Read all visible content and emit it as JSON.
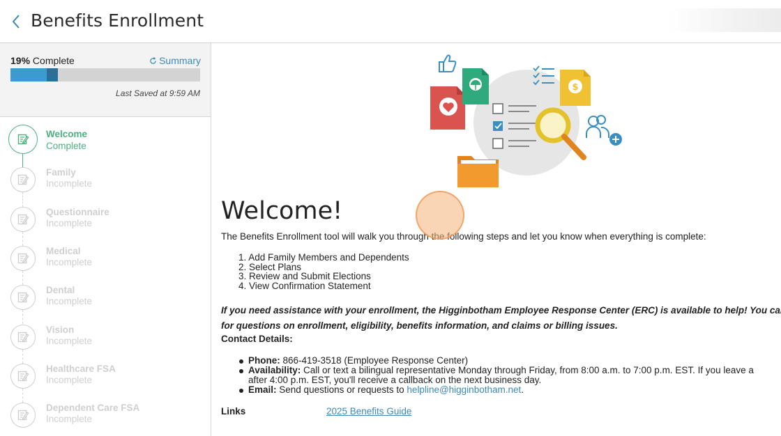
{
  "header": {
    "title": "Benefits Enrollment",
    "back_icon": "chevron-left-icon"
  },
  "progress": {
    "percent_label": "19%",
    "complete_label": "Complete",
    "percent_value": 19,
    "summary_label": "Summary",
    "summary_icon": "refresh-icon",
    "last_saved": "Last Saved at 9:59 AM"
  },
  "steps": [
    {
      "name": "Welcome",
      "status": "Complete",
      "active": true
    },
    {
      "name": "Family",
      "status": "Incomplete"
    },
    {
      "name": "Questionnaire",
      "status": "Incomplete"
    },
    {
      "name": "Medical",
      "status": "Incomplete"
    },
    {
      "name": "Dental",
      "status": "Incomplete"
    },
    {
      "name": "Vision",
      "status": "Incomplete"
    },
    {
      "name": "Healthcare FSA",
      "status": "Incomplete"
    },
    {
      "name": "Dependent Care FSA",
      "status": "Incomplete"
    }
  ],
  "main": {
    "heading": "Welcome!",
    "intro": "The Benefits Enrollment tool will walk you through the following steps and let you know when everything is complete:",
    "list": [
      "1. Add Family Members and Dependents",
      "2. Select Plans",
      "3. Review and Submit Elections",
      "4. View Confirmation Statement"
    ],
    "assist_line1": "If you need assistance with your enrollment, the Higginbotham Employee Response Center (ERC) is available to help! You can",
    "assist_line2": "for questions on enrollment, eligibility, benefits information, and claims or billing issues.",
    "contact_heading": "Contact Details:",
    "phone_label": "Phone:",
    "phone_text": "866-419-3518 (Employee Response Center)",
    "availability_label": "Availability:",
    "availability_text": "Call or text a bilingual representative Monday through Friday, from 8:00 a.m. to 7:00 p.m. EST. If you leave a",
    "availability_cont": "after 4:00 p.m. EST, you'll receive a callback on the next business day.",
    "email_label": "Email:",
    "email_text": "Send questions or requests to",
    "email_link": "helpline@higginbotham.net",
    "email_end": ".",
    "links_label": "Links",
    "guide_link": "2025 Benefits Guide"
  },
  "colors": {
    "accent_green": "#4cb07f",
    "progress_blue": "#3d9ad1",
    "progress_dark": "#2a6f9a",
    "link_blue": "#3a89b8"
  }
}
